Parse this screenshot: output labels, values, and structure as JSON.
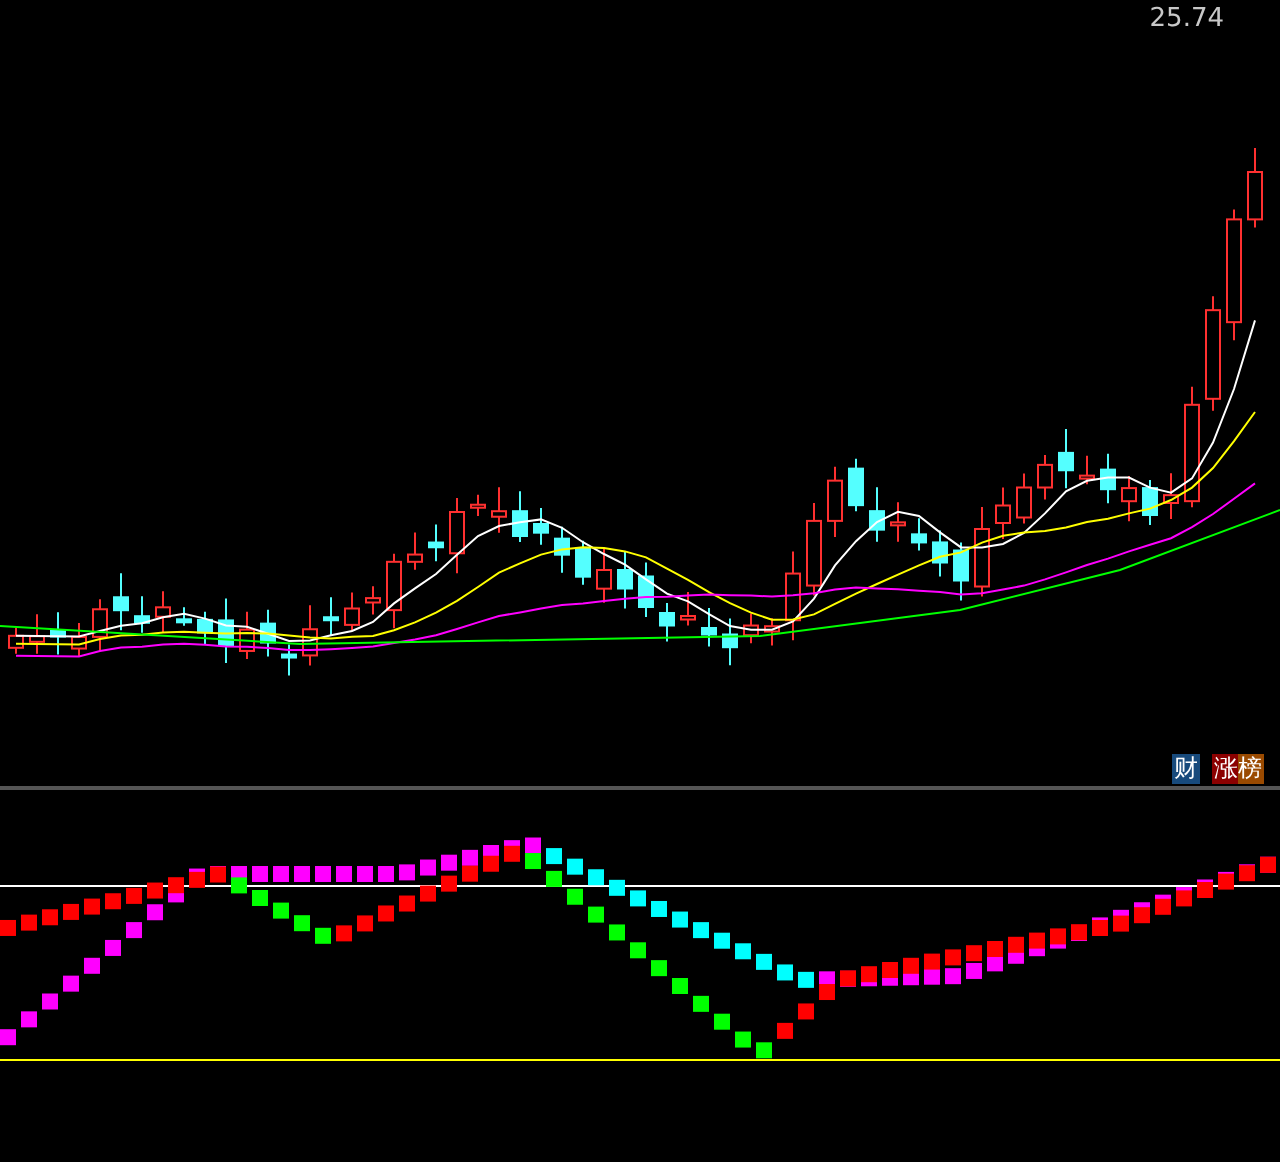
{
  "price_chart": {
    "price_label": "25.74",
    "badges": [
      {
        "text": "财",
        "kind": "finance"
      },
      {
        "text": "涨榜",
        "kind": "rank"
      }
    ]
  }
}
